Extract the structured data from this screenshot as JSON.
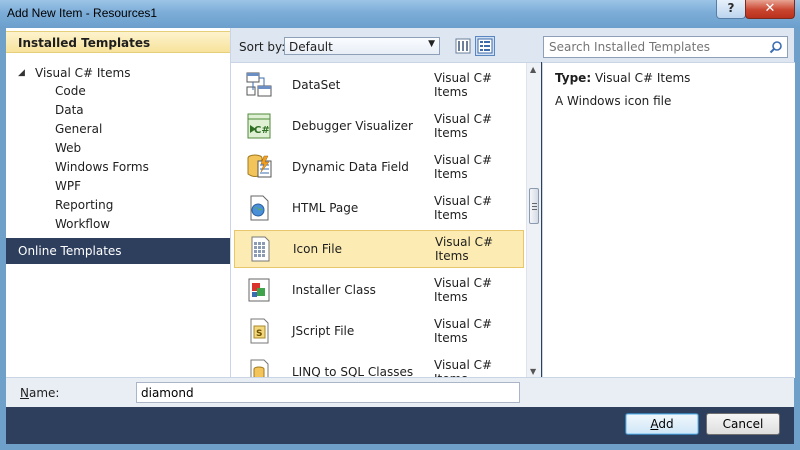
{
  "window": {
    "title": "Add New Item - Resources1",
    "help": "?",
    "close": "✕"
  },
  "left": {
    "installed_header": "Installed Templates",
    "root": "Visual C# Items",
    "items": [
      "Code",
      "Data",
      "General",
      "Web",
      "Windows Forms",
      "WPF",
      "Reporting",
      "Workflow"
    ],
    "online": "Online Templates"
  },
  "toolbar": {
    "sort_label": "Sort by:",
    "sort_value": "Default",
    "search_placeholder": "Search Installed Templates"
  },
  "templates": [
    {
      "name": "DataSet",
      "category": "Visual C# Items",
      "icon": "dataset-icon"
    },
    {
      "name": "Debugger Visualizer",
      "category": "Visual C# Items",
      "icon": "debugger-visualizer-icon"
    },
    {
      "name": "Dynamic Data Field",
      "category": "Visual C# Items",
      "icon": "dynamic-data-field-icon"
    },
    {
      "name": "HTML Page",
      "category": "Visual C# Items",
      "icon": "html-page-icon"
    },
    {
      "name": "Icon File",
      "category": "Visual C# Items",
      "icon": "icon-file-icon",
      "selected": true
    },
    {
      "name": "Installer Class",
      "category": "Visual C# Items",
      "icon": "installer-class-icon"
    },
    {
      "name": "JScript File",
      "category": "Visual C# Items",
      "icon": "jscript-file-icon"
    },
    {
      "name": "LINQ to SQL Classes",
      "category": "Visual C# Items",
      "icon": "linq-to-sql-icon"
    }
  ],
  "details": {
    "type_label": "Type:",
    "type_value": "Visual C# Items",
    "description": "A Windows icon file"
  },
  "footer": {
    "name_label_prefix": "N",
    "name_label_rest": "ame:",
    "name_value": "diamond",
    "add_prefix": "A",
    "add_rest": "dd",
    "cancel": "Cancel"
  }
}
